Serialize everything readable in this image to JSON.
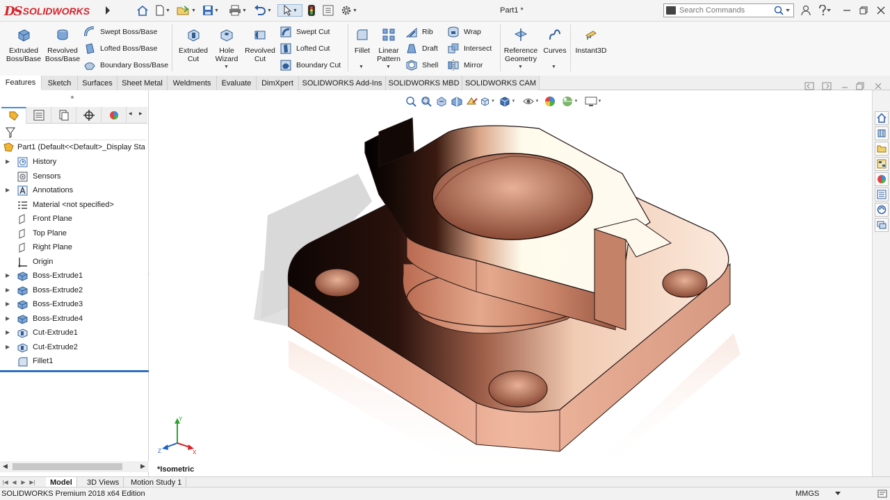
{
  "app": {
    "logo_text": "SOLIDWORKS",
    "document_title": "Part1 *"
  },
  "search": {
    "placeholder": "Search Commands"
  },
  "ribbon": {
    "extruded_boss": "Extruded\nBoss/Base",
    "revolved_boss": "Revolved\nBoss/Base",
    "swept_boss": "Swept Boss/Base",
    "lofted_boss": "Lofted Boss/Base",
    "boundary_boss": "Boundary Boss/Base",
    "extruded_cut": "Extruded\nCut",
    "hole_wizard": "Hole\nWizard",
    "revolved_cut": "Revolved\nCut",
    "swept_cut": "Swept Cut",
    "lofted_cut": "Lofted Cut",
    "boundary_cut": "Boundary Cut",
    "fillet": "Fillet",
    "linear_pattern": "Linear\nPattern",
    "rib": "Rib",
    "draft": "Draft",
    "shell": "Shell",
    "wrap": "Wrap",
    "intersect": "Intersect",
    "mirror": "Mirror",
    "reference_geometry": "Reference\nGeometry",
    "curves": "Curves",
    "instant3d": "Instant3D"
  },
  "command_tabs": [
    "Features",
    "Sketch",
    "Surfaces",
    "Sheet Metal",
    "Weldments",
    "Evaluate",
    "DimXpert",
    "SOLIDWORKS Add-Ins",
    "SOLIDWORKS MBD",
    "SOLIDWORKS CAM"
  ],
  "tree": {
    "root": "Part1  (Default<<Default>_Display Sta",
    "items": [
      "History",
      "Sensors",
      "Annotations",
      "Material <not specified>",
      "Front Plane",
      "Top Plane",
      "Right Plane",
      "Origin",
      "Boss-Extrude1",
      "Boss-Extrude2",
      "Boss-Extrude3",
      "Boss-Extrude4",
      "Cut-Extrude1",
      "Cut-Extrude2",
      "Fillet1"
    ]
  },
  "viewport": {
    "view_label": "*Isometric",
    "triad": {
      "x": "X",
      "y": "Y",
      "z": "Z"
    }
  },
  "bottom_tabs": [
    "Model",
    "3D Views",
    "Motion Study 1"
  ],
  "status": {
    "edition": "SOLIDWORKS Premium 2018 x64 Edition",
    "units": "MMGS"
  },
  "colors": {
    "brand_red": "#d5232b",
    "accent_blue": "#2f6fc0",
    "part_copper": "#c88a73"
  }
}
